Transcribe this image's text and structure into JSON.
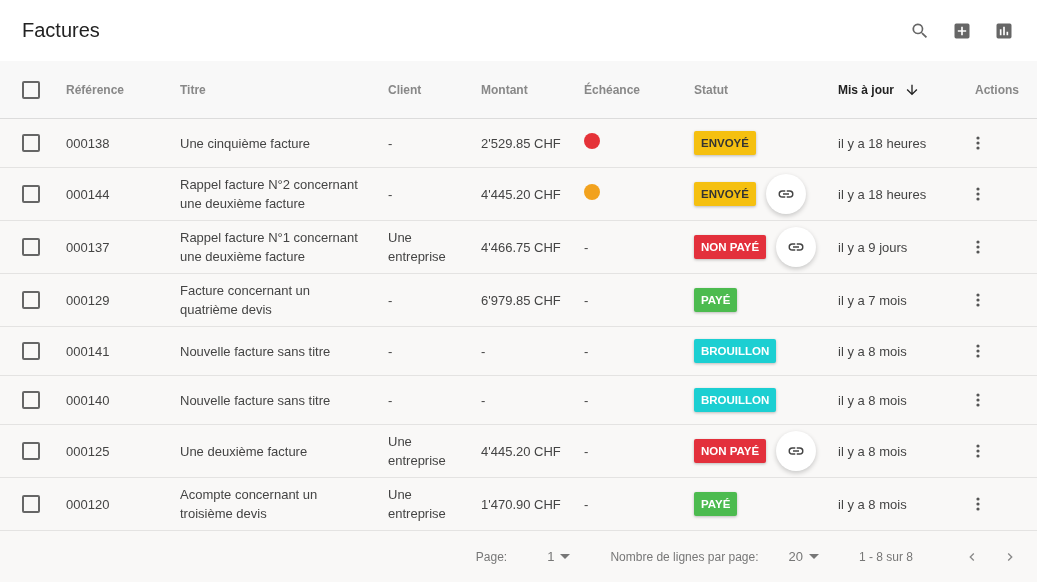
{
  "header": {
    "title": "Factures"
  },
  "table": {
    "select_all": {
      "checked": false
    },
    "columns": [
      {
        "label": "Référence",
        "sorted": false
      },
      {
        "label": "Titre",
        "sorted": false
      },
      {
        "label": "Client",
        "sorted": false
      },
      {
        "label": "Montant",
        "sorted": false
      },
      {
        "label": "Échéance",
        "sorted": false
      },
      {
        "label": "Statut",
        "sorted": false
      },
      {
        "label": "Mis à jour",
        "sorted": true
      },
      {
        "label": "Actions",
        "sorted": false
      }
    ],
    "rows": [
      {
        "checked": false,
        "reference": "000138",
        "title": "Une cinquième facture",
        "client": "-",
        "amount": "2'529.85 CHF",
        "due": {
          "kind": "dot",
          "color": "#e53238"
        },
        "status": {
          "kind": "sent",
          "label": "ENVOYÉ"
        },
        "link": false,
        "updated": "il y a 18 heures"
      },
      {
        "checked": false,
        "reference": "000144",
        "title": "Rappel facture N°2 concernant une deuxième facture",
        "client": "-",
        "amount": "4'445.20 CHF",
        "due": {
          "kind": "dot",
          "color": "#f2a21e"
        },
        "status": {
          "kind": "sent",
          "label": "ENVOYÉ"
        },
        "link": true,
        "updated": "il y a 18 heures"
      },
      {
        "checked": false,
        "reference": "000137",
        "title": "Rappel facture N°1 concernant une deuxième facture",
        "client": "Une entreprise",
        "amount": "4'466.75 CHF",
        "due": {
          "kind": "text",
          "text": "-"
        },
        "status": {
          "kind": "unpaid",
          "label": "NON PAYÉ"
        },
        "link": true,
        "updated": "il y a 9 jours"
      },
      {
        "checked": false,
        "reference": "000129",
        "title": "Facture concernant un quatrième devis",
        "client": "-",
        "amount": "6'979.85 CHF",
        "due": {
          "kind": "text",
          "text": "-"
        },
        "status": {
          "kind": "paid",
          "label": "PAYÉ"
        },
        "link": false,
        "updated": "il y a 7 mois"
      },
      {
        "checked": false,
        "reference": "000141",
        "title": "Nouvelle facture sans titre",
        "client": "-",
        "amount": "-",
        "due": {
          "kind": "text",
          "text": "-"
        },
        "status": {
          "kind": "draft",
          "label": "BROUILLON"
        },
        "link": false,
        "updated": "il y a 8 mois"
      },
      {
        "checked": false,
        "reference": "000140",
        "title": "Nouvelle facture sans titre",
        "client": "-",
        "amount": "-",
        "due": {
          "kind": "text",
          "text": "-"
        },
        "status": {
          "kind": "draft",
          "label": "BROUILLON"
        },
        "link": false,
        "updated": "il y a 8 mois"
      },
      {
        "checked": false,
        "reference": "000125",
        "title": "Une deuxième facture",
        "client": "Une entreprise",
        "amount": "4'445.20 CHF",
        "due": {
          "kind": "text",
          "text": "-"
        },
        "status": {
          "kind": "unpaid",
          "label": "NON PAYÉ"
        },
        "link": true,
        "updated": "il y a 8 mois"
      },
      {
        "checked": false,
        "reference": "000120",
        "title": "Acompte concernant un troisième devis",
        "client": "Une entreprise",
        "amount": "1'470.90 CHF",
        "due": {
          "kind": "text",
          "text": "-"
        },
        "status": {
          "kind": "paid",
          "label": "PAYÉ"
        },
        "link": false,
        "updated": "il y a 8 mois"
      }
    ]
  },
  "pagination": {
    "page_label": "Page:",
    "page": "1",
    "rows_label": "Nombre de lignes par page:",
    "rows_per_page": "20",
    "range": "1 - 8 sur 8"
  }
}
